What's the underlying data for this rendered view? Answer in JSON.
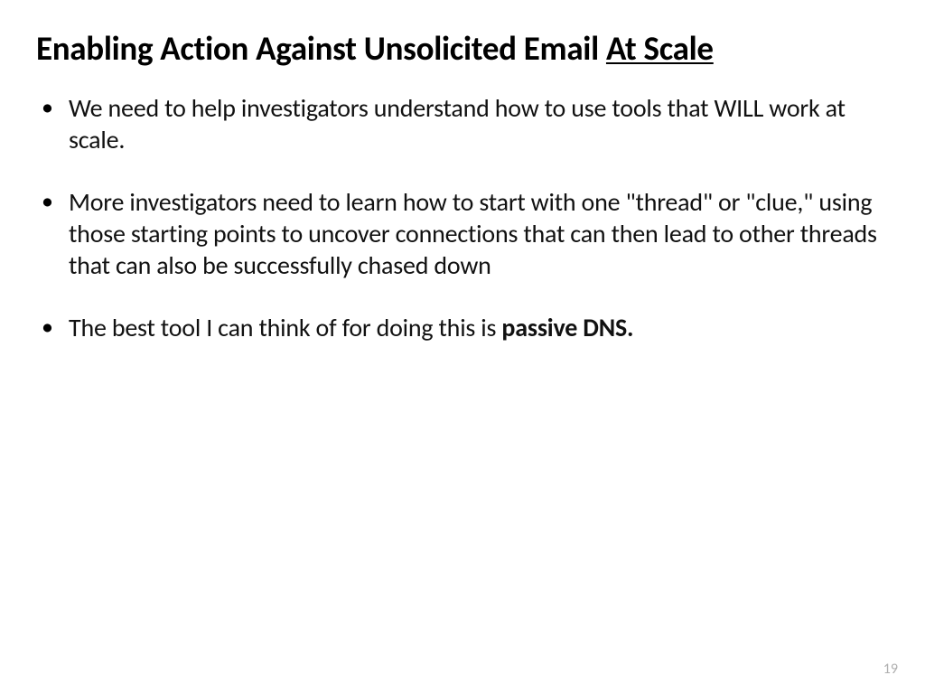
{
  "slide": {
    "title_prefix": "Enabling Action Against Unsolicited Email ",
    "title_underlined": "At Scale",
    "bullets": [
      {
        "text": "We need to help investigators understand how to use tools that WILL work at scale."
      },
      {
        "text": "More investigators need to learn how to start with one \"thread\" or \"clue,\" using those starting points to uncover connections that can then lead to other threads that can also be successfully chased down"
      },
      {
        "text_prefix": "The best tool I can think of for doing this is ",
        "text_bold": "passive DNS."
      }
    ],
    "page_number": "19"
  }
}
